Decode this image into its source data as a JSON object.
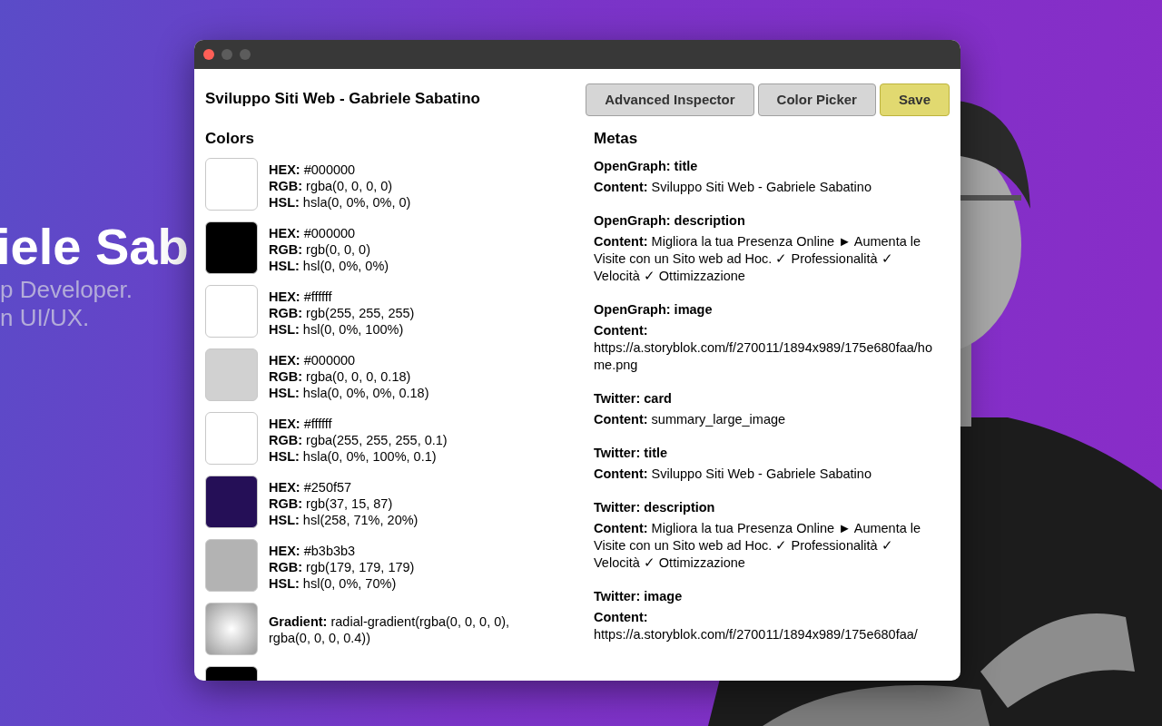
{
  "hero": {
    "name_fragment": "iele Sab",
    "lines": [
      "p Developer.",
      "n UI/UX."
    ]
  },
  "window": {
    "title": "Sviluppo Siti Web - Gabriele Sabatino",
    "buttons": [
      {
        "label": "Advanced Inspector",
        "kind": "default"
      },
      {
        "label": "Color Picker",
        "kind": "default"
      },
      {
        "label": "Save",
        "kind": "primary"
      }
    ]
  },
  "colors": {
    "heading": "Colors",
    "items": [
      {
        "kind": "solid",
        "color": "#ffffff",
        "lines": [
          {
            "label": "HEX:",
            "value": "#000000"
          },
          {
            "label": "RGB:",
            "value": "rgba(0, 0, 0, 0)"
          },
          {
            "label": "HSL:",
            "value": "hsla(0, 0%, 0%, 0)"
          }
        ]
      },
      {
        "kind": "solid",
        "color": "#000000",
        "lines": [
          {
            "label": "HEX:",
            "value": "#000000"
          },
          {
            "label": "RGB:",
            "value": "rgb(0, 0, 0)"
          },
          {
            "label": "HSL:",
            "value": "hsl(0, 0%, 0%)"
          }
        ]
      },
      {
        "kind": "solid",
        "color": "#ffffff",
        "lines": [
          {
            "label": "HEX:",
            "value": "#ffffff"
          },
          {
            "label": "RGB:",
            "value": "rgb(255, 255, 255)"
          },
          {
            "label": "HSL:",
            "value": "hsl(0, 0%, 100%)"
          }
        ]
      },
      {
        "kind": "solid",
        "color": "#d1d1d1",
        "lines": [
          {
            "label": "HEX:",
            "value": "#000000"
          },
          {
            "label": "RGB:",
            "value": "rgba(0, 0, 0, 0.18)"
          },
          {
            "label": "HSL:",
            "value": "hsla(0, 0%, 0%, 0.18)"
          }
        ]
      },
      {
        "kind": "solid",
        "color": "#ffffff",
        "lines": [
          {
            "label": "HEX:",
            "value": "#ffffff"
          },
          {
            "label": "RGB:",
            "value": "rgba(255, 255, 255, 0.1)"
          },
          {
            "label": "HSL:",
            "value": "hsla(0, 0%, 100%, 0.1)"
          }
        ]
      },
      {
        "kind": "solid",
        "color": "#250f57",
        "lines": [
          {
            "label": "HEX:",
            "value": "#250f57"
          },
          {
            "label": "RGB:",
            "value": "rgb(37, 15, 87)"
          },
          {
            "label": "HSL:",
            "value": "hsl(258, 71%, 20%)"
          }
        ]
      },
      {
        "kind": "solid",
        "color": "#b3b3b3",
        "lines": [
          {
            "label": "HEX:",
            "value": "#b3b3b3"
          },
          {
            "label": "RGB:",
            "value": "rgb(179, 179, 179)"
          },
          {
            "label": "HSL:",
            "value": "hsl(0, 0%, 70%)"
          }
        ]
      },
      {
        "kind": "gradient",
        "lines": [
          {
            "label": "Gradient:",
            "value": "radial-gradient(rgba(0, 0, 0, 0), rgba(0, 0, 0, 0.4))"
          }
        ]
      },
      {
        "kind": "solid",
        "color": "#000000"
      }
    ]
  },
  "metas": {
    "heading": "Metas",
    "items": [
      {
        "name": "OpenGraph: title",
        "content": "**Content:** Sviluppo Siti Web - Gabriele Sabatino"
      },
      {
        "name": "OpenGraph: description",
        "content": "**Content:** Migliora la tua Presenza Online ► Aumenta le Visite con un Sito web ad Hoc. ✓ Professionalità ✓ Velocità ✓ Ottimizzazione"
      },
      {
        "name": "OpenGraph: image",
        "content": "**Content:** https://a.storyblok.com/f/270011/1894x989/175e680faa/home.png"
      },
      {
        "name": "Twitter: card",
        "content": "**Content:** summary_large_image"
      },
      {
        "name": "Twitter: title",
        "content": "**Content:** Sviluppo Siti Web - Gabriele Sabatino"
      },
      {
        "name": "Twitter: description",
        "content": "**Content:** Migliora la tua Presenza Online ► Aumenta le Visite con un Sito web ad Hoc. ✓ Professionalità ✓ Velocità ✓ Ottimizzazione"
      },
      {
        "name": "Twitter: image",
        "content": "**Content:** https://a.storyblok.com/f/270011/1894x989/175e680faa/"
      }
    ]
  }
}
